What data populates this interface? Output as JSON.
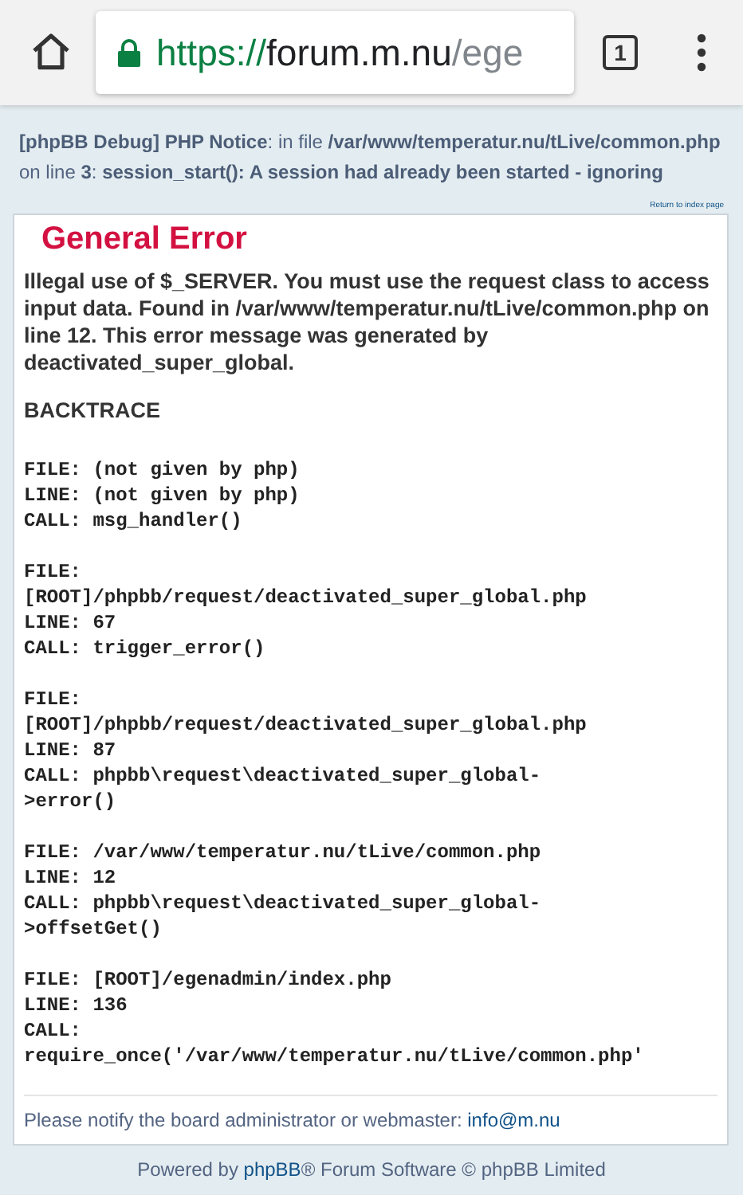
{
  "browser": {
    "url_scheme": "https://",
    "url_host": "forum.m.nu",
    "url_path": "/ege",
    "tab_count": "1"
  },
  "notice": "**[phpBB Debug] PHP Notice**: in file **/var/www/temperatur.nu/tLive/common.php** on line **3**: **session_start(): A session had already been started - ignoring**",
  "return_link": "Return to index page",
  "error": {
    "title": "General Error",
    "message": "Illegal use of $_SERVER. You must use the request class to access input data. Found in /var/www/temperatur.nu/tLive/common.php on line 12. This error message was generated by deactivated_super_global.",
    "backtrace_heading": "BACKTRACE",
    "backtrace": [
      {
        "lines": [
          "FILE: (not given by php)",
          "LINE: (not given by php)",
          "CALL: msg_handler()"
        ]
      },
      {
        "lines": [
          "FILE:",
          "[ROOT]/phpbb/request/deactivated_super_global.php",
          "LINE: 67",
          "CALL: trigger_error()"
        ]
      },
      {
        "lines": [
          "FILE:",
          "[ROOT]/phpbb/request/deactivated_super_global.php",
          "LINE: 87",
          "CALL: phpbb\\request\\deactivated_super_global-",
          ">error()"
        ]
      },
      {
        "lines": [
          "FILE: /var/www/temperatur.nu/tLive/common.php",
          "LINE: 12",
          "CALL: phpbb\\request\\deactivated_super_global-",
          ">offsetGet()"
        ]
      },
      {
        "lines": [
          "FILE: [ROOT]/egenadmin/index.php",
          "LINE: 136",
          "CALL:",
          "require_once('/var/www/temperatur.nu/tLive/common.php'"
        ]
      }
    ],
    "notify_text": "Please notify the board administrator or webmaster: ",
    "notify_email": "info@m.nu"
  },
  "footer": {
    "prefix": "Powered by ",
    "link": "phpBB",
    "suffix": "® Forum Software © phpBB Limited"
  }
}
